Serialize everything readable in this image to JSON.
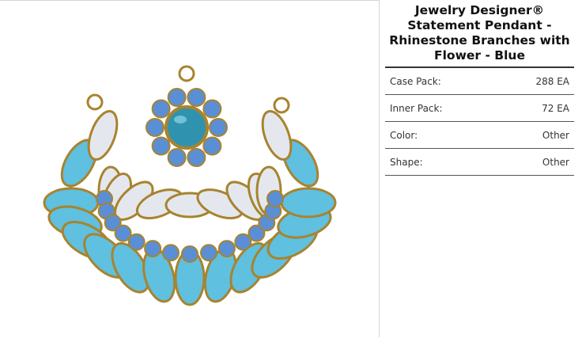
{
  "product": {
    "title": "Jewelry Designer® Statement Pendant - Rhinestone Branches with Flower - Blue",
    "image_alt": "Rhinestone statement pendant with turquoise marquise stones, clear crystals and blue rhinestone flower on antique gold setting"
  },
  "specs": [
    {
      "label": "Case Pack:",
      "value": "288 EA"
    },
    {
      "label": "Inner Pack:",
      "value": "72 EA"
    },
    {
      "label": "Color:",
      "value": "Other"
    },
    {
      "label": "Shape:",
      "value": "Other"
    }
  ],
  "colors": {
    "turquoise": "#5fc0df",
    "crystal": "#e4e8ee",
    "sapphire": "#5a8fd6",
    "gold": "#a8832e",
    "center": "#2f93b0"
  }
}
